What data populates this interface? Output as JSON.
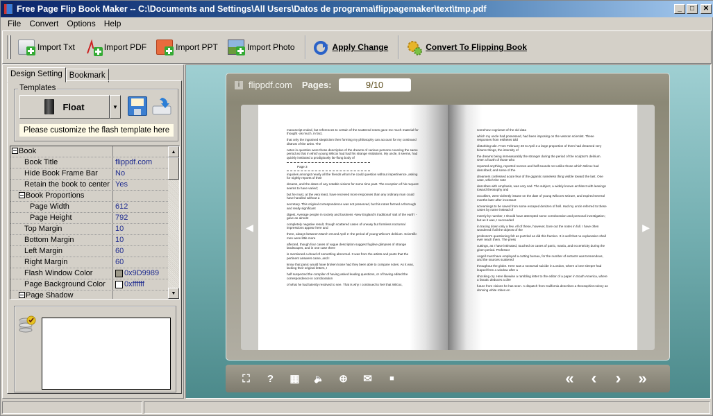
{
  "window": {
    "title": "Free Page Flip Book Maker -- C:\\Documents and Settings\\All Users\\Datos de programa\\flippagemaker\\text\\tmp.pdf",
    "controls": {
      "minimize": "_",
      "maximize": "□",
      "close": "✕"
    }
  },
  "menu": [
    "File",
    "Convert",
    "Options",
    "Help"
  ],
  "toolbar": {
    "import_txt": "Import Txt",
    "import_pdf": "Import PDF",
    "import_ppt": "Import PPT",
    "import_photo": "Import Photo",
    "apply_change": "Apply Change",
    "convert": "Convert To Flipping Book"
  },
  "left_panel": {
    "tabs": [
      "Design Setting",
      "Bookmark"
    ],
    "templates_label": "Templates",
    "template_name": "Float",
    "hint": "Please customize the flash template here",
    "properties": [
      {
        "key": "Book",
        "value": "",
        "type": "cat1"
      },
      {
        "key": "Book Title",
        "value": "flippdf.com",
        "type": "item"
      },
      {
        "key": "Hide Book Frame Bar",
        "value": "No",
        "type": "item"
      },
      {
        "key": "Retain the book to center",
        "value": "Yes",
        "type": "item"
      },
      {
        "key": "Book Proportions",
        "value": "",
        "type": "cat"
      },
      {
        "key": "Page Width",
        "value": "612",
        "type": "sub"
      },
      {
        "key": "Page Height",
        "value": "792",
        "type": "sub"
      },
      {
        "key": "Top Margin",
        "value": "10",
        "type": "item"
      },
      {
        "key": "Bottom Margin",
        "value": "10",
        "type": "item"
      },
      {
        "key": "Left Margin",
        "value": "60",
        "type": "item"
      },
      {
        "key": "Right Margin",
        "value": "60",
        "type": "item"
      },
      {
        "key": "Flash Window Color",
        "value": "0x9D9989",
        "type": "item",
        "swatch": "#9D9989"
      },
      {
        "key": "Page Background Color",
        "value": "0xffffff",
        "type": "item",
        "swatch": "#ffffff"
      },
      {
        "key": "Page Shadow",
        "value": "",
        "type": "cat"
      }
    ]
  },
  "preview": {
    "site": "flippdf.com",
    "pages_label": "Pages:",
    "pages_value": "9/10",
    "left_page": {
      "paragraphs": [
        "manuscript ended, but references to certain of the scattered notes gave me much material for thought -as much, in fact,",
        "that only the ingrained skepticism then forming my philosophy can account for my continued distrust of the artist. The",
        "notes in question were those descriptive of the dreams of various persons covering the same period as that in which young Wilcox had had his strange visitations. My uncle, it seems, had quickly instituted a prodigiously far-flung body of",
        "--RULE--",
        "Page 3",
        "--RULE--",
        "inquiries amongst nearly all the friends whom he could question without impertinence, asking for nightly reports of their",
        "dreams, and the dates of any notable visions for some time past. The reception of his request seems to have varied;",
        "but he must, at the very least, have received more responses than any ordinary man could have handled without a",
        "secretary. This original correspondence was not preserved, but his notes formed a thorough and really significant",
        "digest. Average people in society and business -New England's traditional 'salt of the earth' -gave an almost",
        "completely negative result, though scattered cases of uneasy but formless nocturnal impressions appear here and",
        "there, always between March 23 and April 2 -the period of young Wilcox's delirium. Scientific men were little more",
        "affected, though four cases of vague description suggest fugitive glimpses of strange landscapes, and in one case there",
        "is mentioned a dread of something abnormal. It was from the artists and poets that the pertinent answers came, and I",
        "know that panic would have broken loose had they been able to compare notes. As it was, lacking their original letters, I",
        "half suspected the compiler of having asked leading questions, or of having edited the correspondence in corroboration",
        "of what he had latently resolved to see. That is why I continued to feel that Wilcox,"
      ]
    },
    "right_page": {
      "paragraphs": [
        "somehow cognizant of the old data",
        "which my uncle had possessed, had been imposing on the veteran scientist. These responses from esthetes told",
        "disturbing tale. From February 28 to April 2 a large proportion of them had dreamed very bizarre things, the intensity of",
        "the dreams being immeasurably the stronger during the period of the sculptor's delirium. Over a fourth of those who",
        "reported anything, reported scenes and half-sounds not unlike those which Wilcox had described; and some of the",
        "dreamers confessed acute fear of the gigantic nameless thing visible toward the last. One case, which the note",
        "describes with emphasis, was very sad. The subject, a widely known architect with leanings toward theosophy and",
        "occultism, went violently insane on the date of young Wilcox's seizure, and expired several months later after incessant",
        "screamings to be saved from some escaped denizen of hell. Had my uncle referred to these cases by name instead of",
        "merely by number, I should have attempted some corroboration and personal investigation; but as it was, I succeeded",
        "in tracing down only a few. All of these, however, bore out the notes in full. I have often wondered if all the objects of the",
        "professor's questioning felt as puzzled as did this fraction. It is well that no explanation shall ever reach them. The press",
        "cuttings, as I have intimated, touched on cases of panic, mania, and eccentricity during the given period. Professor",
        "Angell must have employed a cutting bureau, for the number of extracts was tremendous, and the sources scattered",
        "throughout the globe. Here was a nocturnal suicide in London, where a lone sleeper had leaped from a window after a",
        "shocking cry. Here likewise a rambling letter to the editor of a paper in South America, where a fanatic deduces a dire",
        "future from visions he has seen. A dispatch from California describes a theosophist colony as donning white robes en"
      ]
    },
    "nav": {
      "prev_page": "◀",
      "next_page": "▶"
    },
    "controls": {
      "fullscreen": "⛶",
      "help": "?",
      "thumbnails": "▦",
      "sound": "🔈",
      "zoom": "⊕",
      "email": "✉",
      "stop": "■",
      "first": "«",
      "prev": "‹",
      "next": "›",
      "last": "»"
    }
  },
  "colors": {
    "stage_top": "#9fcfd2",
    "stage_bottom": "#4c8a8b",
    "frame": "#9D9989",
    "value_text": "#1f2c8f"
  }
}
